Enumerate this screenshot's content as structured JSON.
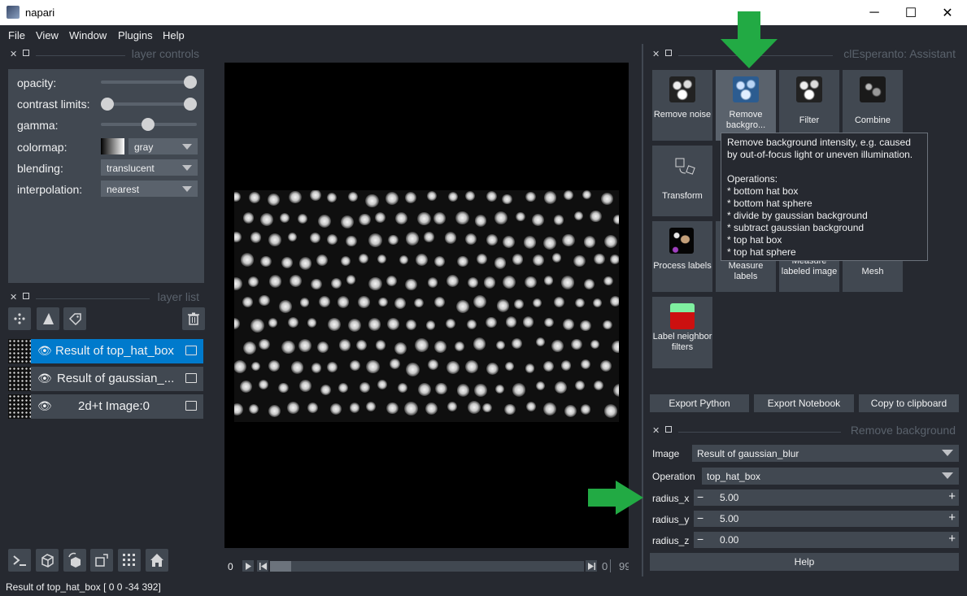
{
  "window": {
    "title": "napari",
    "minimize": "─",
    "maximize": "☐",
    "close": "✕"
  },
  "menu": [
    "File",
    "View",
    "Window",
    "Plugins",
    "Help"
  ],
  "layer_controls": {
    "header": "layer controls",
    "opacity_label": "opacity:",
    "contrast_label": "contrast limits:",
    "gamma_label": "gamma:",
    "colormap_label": "colormap:",
    "colormap_value": "gray",
    "blending_label": "blending:",
    "blending_value": "translucent",
    "interpolation_label": "interpolation:",
    "interpolation_value": "nearest"
  },
  "layer_list": {
    "header": "layer list",
    "layers": [
      {
        "name": "Result of top_hat_box",
        "selected": true
      },
      {
        "name": "Result of gaussian_...",
        "selected": false
      },
      {
        "name": "2d+t Image:0",
        "selected": false
      }
    ]
  },
  "dims": {
    "frame_left": "0",
    "frame_value": "0",
    "frame_max": "99"
  },
  "assistant": {
    "header": "clEsperanto: Assistant",
    "tiles": [
      {
        "label": "Remove noise",
        "icon": "blobs-icon"
      },
      {
        "label": "Remove backgro...",
        "icon": "blobs-blue-icon"
      },
      {
        "label": "Filter",
        "icon": "blobs-filter-icon"
      },
      {
        "label": "Combine",
        "icon": "combine-icon"
      },
      {
        "label": "Transform",
        "icon": "transform-icon"
      },
      {
        "label": "Process labels",
        "icon": "labels-icon"
      },
      {
        "label": "Measure labels",
        "icon": "measure-icon"
      },
      {
        "label": "Measure labeled image",
        "icon": "measure-image-icon"
      },
      {
        "label": "Mesh",
        "icon": "mesh-icon"
      },
      {
        "label": "Label neighbor filters",
        "icon": "label-neighbor-icon"
      }
    ],
    "tooltip": "Remove background intensity, e.g. caused\nby out-of-focus light or uneven illumination.\n\nOperations:\n* bottom hat box\n* bottom hat sphere\n* divide by gaussian background\n* subtract gaussian background\n* top hat box\n* top hat sphere",
    "export_python": "Export Python",
    "export_notebook": "Export Notebook",
    "copy_clipboard": "Copy to clipboard"
  },
  "remove_background": {
    "header": "Remove background",
    "image_label": "Image",
    "image_value": "Result of gaussian_blur",
    "operation_label": "Operation",
    "operation_value": "top_hat_box",
    "radius_x_label": "radius_x",
    "radius_x_value": "5.00",
    "radius_y_label": "radius_y",
    "radius_y_value": "5.00",
    "radius_z_label": "radius_z",
    "radius_z_value": "0.00",
    "help": "Help"
  },
  "status": "Result of top_hat_box [  0   0 -34 392]",
  "colors": {
    "accent": "#007acc",
    "arrow": "#22aa44",
    "bg": "#262930",
    "panel": "#414851"
  }
}
